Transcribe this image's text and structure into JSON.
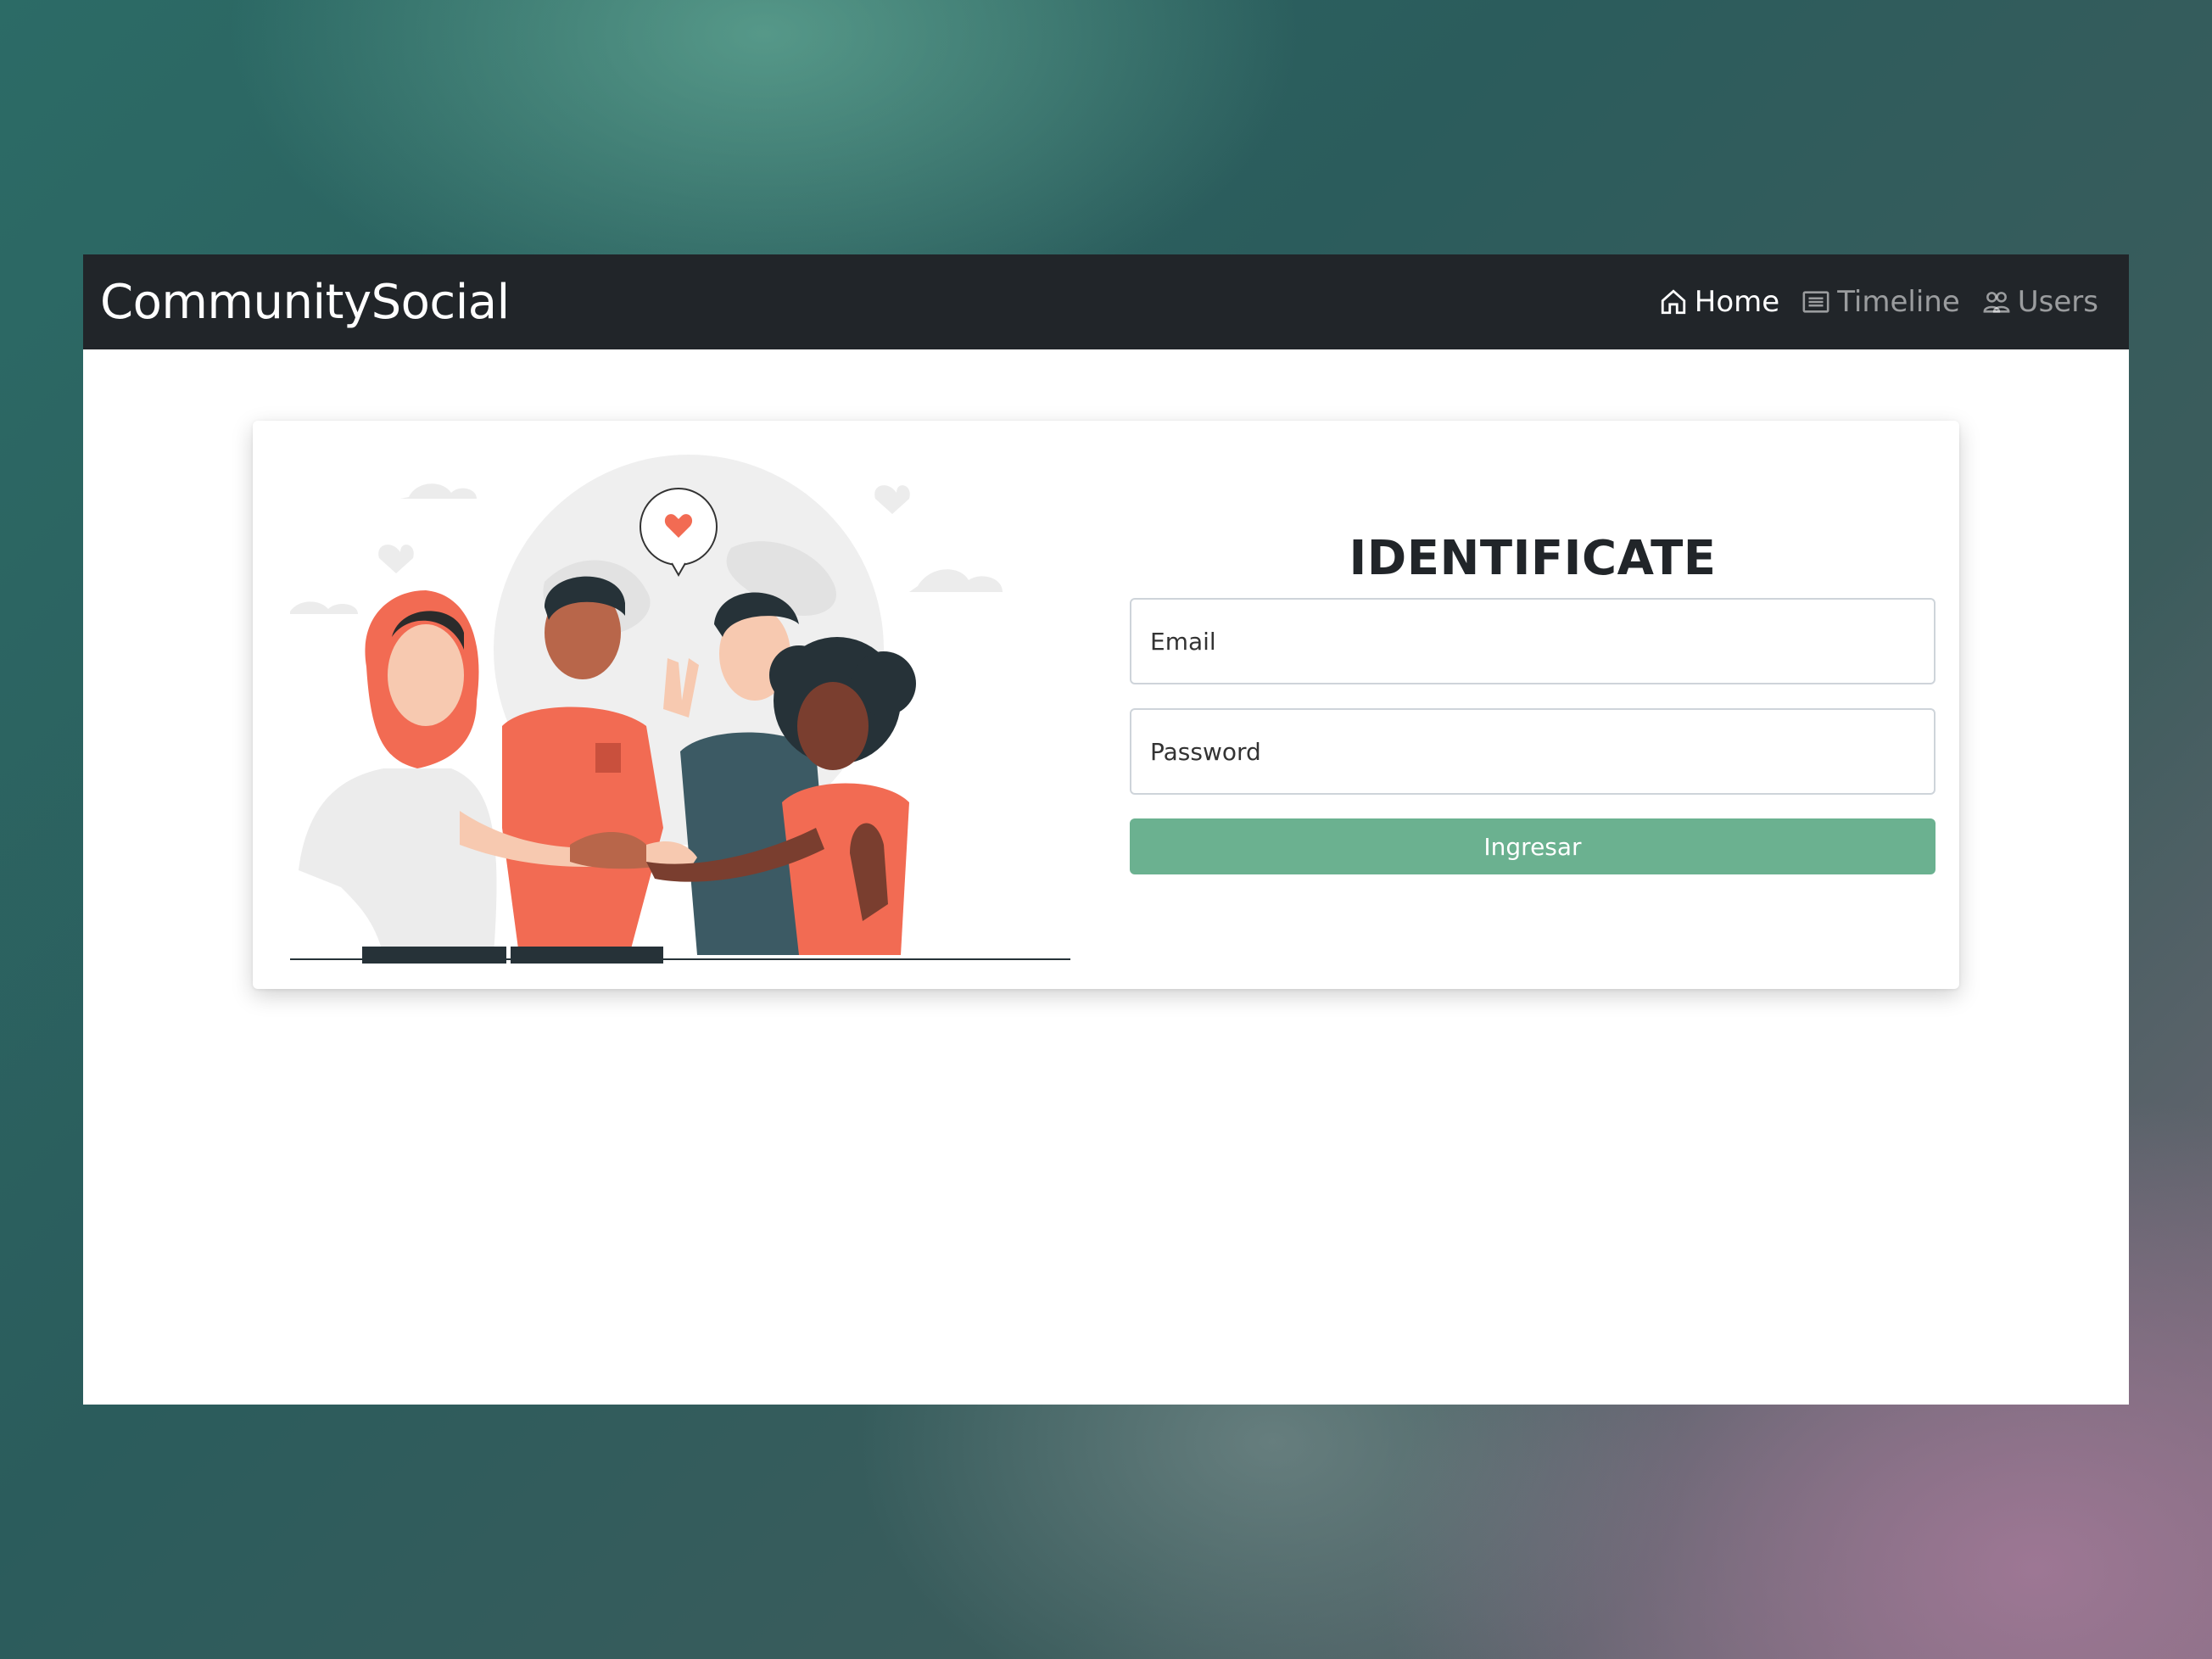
{
  "app": {
    "brand": "CommunitySocial"
  },
  "nav": {
    "items": [
      {
        "label": "Home",
        "icon": "home-icon",
        "active": true
      },
      {
        "label": "Timeline",
        "icon": "list-icon",
        "active": false
      },
      {
        "label": "Users",
        "icon": "users-icon",
        "active": false
      }
    ]
  },
  "login": {
    "title": "IDENTIFICATE",
    "email": {
      "placeholder": "Email",
      "value": ""
    },
    "password": {
      "placeholder": "Password",
      "value": ""
    },
    "submit_label": "Ingresar"
  },
  "colors": {
    "navbar": "#212529",
    "button": "#6bb190",
    "accent_orange": "#f26b53",
    "accent_teal": "#3c5a64"
  }
}
